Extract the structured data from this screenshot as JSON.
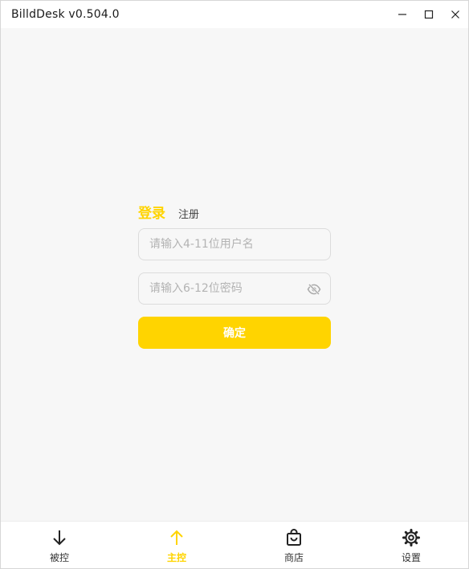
{
  "window": {
    "title": "BilldDesk v0.504.0",
    "controls": [
      "minimize-icon",
      "maximize-icon",
      "close-icon"
    ]
  },
  "auth": {
    "tab_login": "登录",
    "tab_register": "注册",
    "active_tab": "login",
    "username_placeholder": "请输入4-11位用户名",
    "username_value": "",
    "password_placeholder": "请输入6-12位密码",
    "password_value": "",
    "password_toggle_icon": "eye-off-icon",
    "confirm_label": "确定"
  },
  "nav": {
    "items": [
      {
        "label": "被控",
        "icon": "arrow-down-icon",
        "active": false
      },
      {
        "label": "主控",
        "icon": "arrow-up-icon",
        "active": true
      },
      {
        "label": "商店",
        "icon": "shopping-bag-icon",
        "active": false
      },
      {
        "label": "设置",
        "icon": "gear-icon",
        "active": false
      }
    ]
  },
  "colors": {
    "accent": "#ffd400",
    "background": "#f7f7f7",
    "text": "#333333",
    "placeholder": "#b3b3b3"
  }
}
